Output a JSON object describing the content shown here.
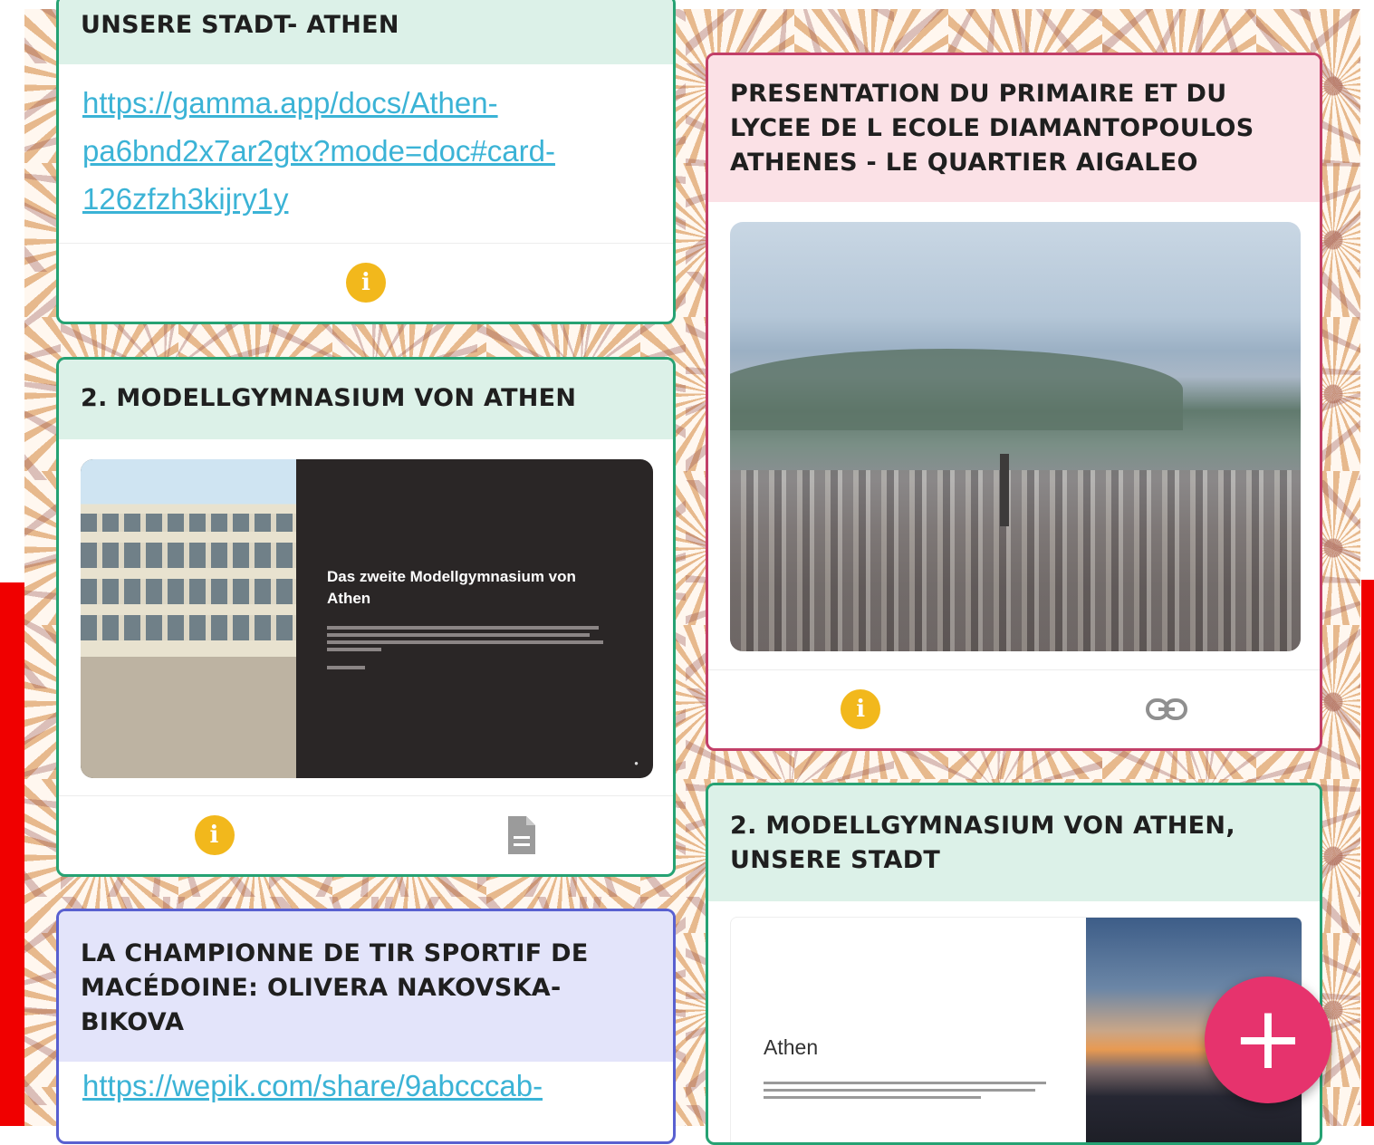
{
  "cards": {
    "c1": {
      "title": "UNSERE STADT- ATHEN",
      "link": "https://gamma.app/docs/Athen-pa6bnd2x7ar2gtx?mode=doc#card-126zfzh3kijry1y"
    },
    "c2": {
      "title": "2. MODELLGYMNASIUM VON ATHEN",
      "preview_title": "Das zweite Modellgymnasium von Athen"
    },
    "c3": {
      "title": "LA CHAMPIONNE DE TIR SPORTIF DE MACÉDOINE: OLIVERA NAKOVSKA-BIKOVA",
      "link": "https://wepik.com/share/9abcccab-"
    },
    "c4": {
      "title": "PRESENTATION DU PRIMAIRE ET DU LYCEE DE L ECOLE DIAMANTOPOULOS ATHENES - LE QUARTIER AIGALEO"
    },
    "c5": {
      "title": "2. MODELLGYMNASIUM VON ATHEN, UNSERE STADT",
      "preview_title": "Athen"
    }
  },
  "icons": {
    "info": "i",
    "add": "+"
  },
  "colors": {
    "info": "#f2b81c",
    "fab": "#e6336d",
    "link": "#3bb3d6",
    "green_border": "#26a273",
    "pink_border": "#c23f68",
    "blue_border": "#5960d0"
  }
}
